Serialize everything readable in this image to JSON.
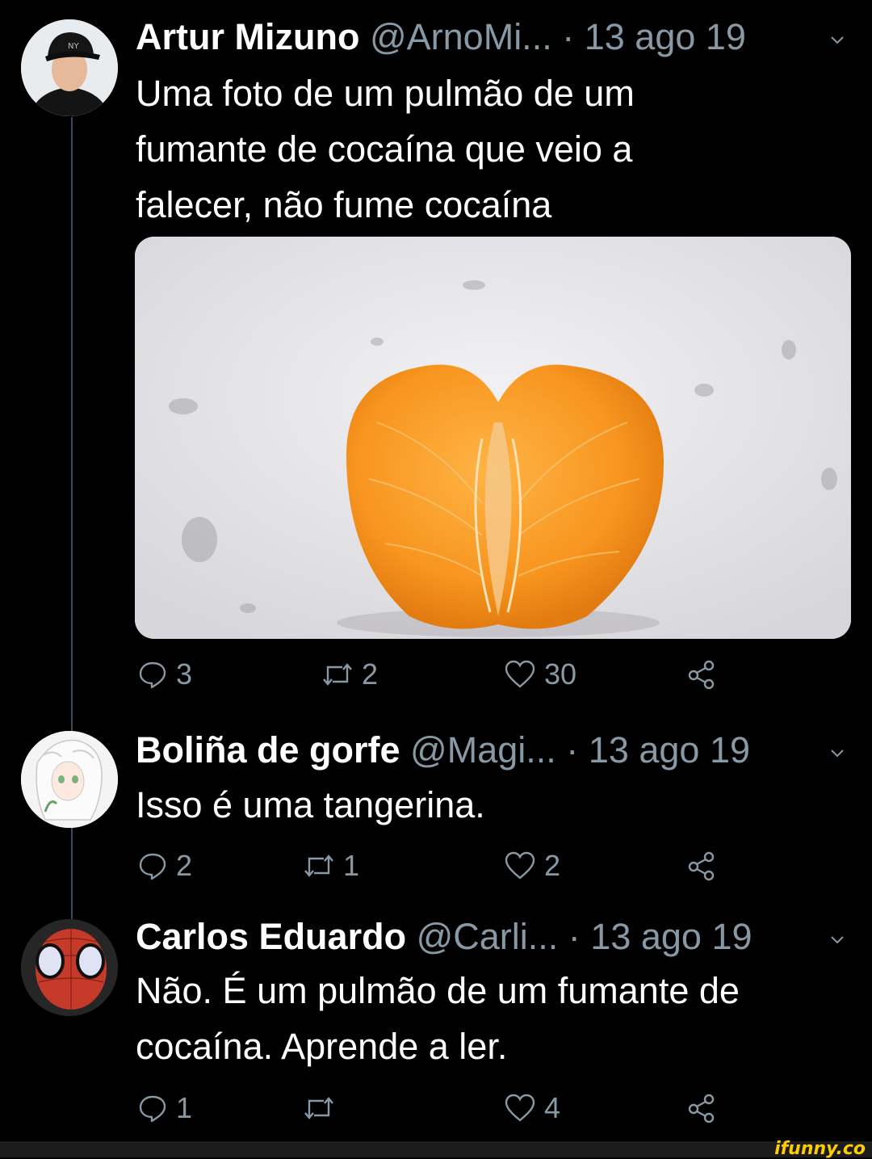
{
  "tweets": [
    {
      "name": "Artur Mizuno",
      "handle": "@ArnoMi...",
      "separator": "·",
      "date": "13 ago 19",
      "text_lines": [
        "Uma foto de um pulmão de um",
        "fumante de cocaína que veio a",
        "falecer, não fume cocaína"
      ],
      "replies": "3",
      "retweets": "2",
      "likes": "30",
      "has_media": true
    },
    {
      "name": "Boliña de gorfe",
      "handle": "@Magi...",
      "separator": "·",
      "date": "13 ago 19",
      "text_lines": [
        "Isso é uma tangerina."
      ],
      "replies": "2",
      "retweets": "1",
      "likes": "2"
    },
    {
      "name": "Carlos Eduardo",
      "handle": "@Carli...",
      "separator": "·",
      "date": "13 ago 19",
      "text_lines": [
        "Não. É um pulmão de um fumante de",
        "cocaína. Aprende a ler."
      ],
      "replies": "1",
      "retweets": "",
      "likes": "4"
    }
  ],
  "icons": {
    "reply": "reply-icon",
    "retweet": "retweet-icon",
    "like": "heart-icon",
    "share": "share-icon",
    "more": "chevron-down-icon"
  },
  "colors": {
    "background": "#000000",
    "secondary_text": "#8899a6",
    "thread_line": "#3d4a56",
    "watermark": "#ffcc00"
  },
  "watermark": "ifunny.co"
}
